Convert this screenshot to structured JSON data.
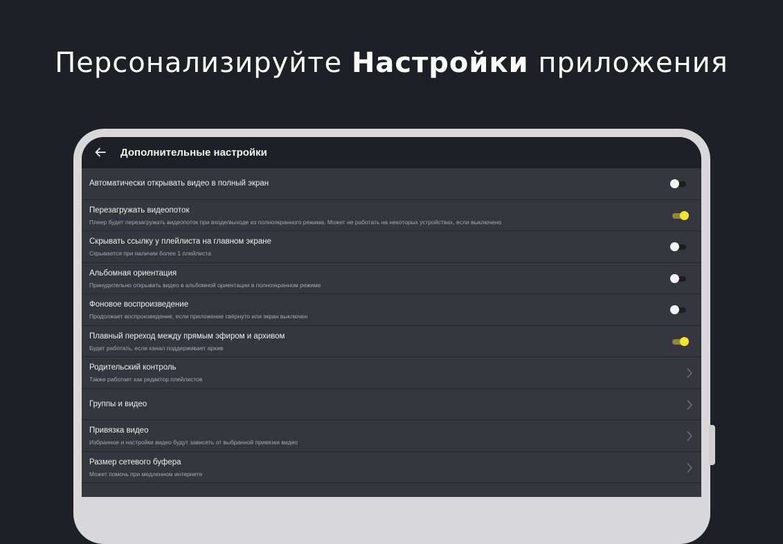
{
  "headline": {
    "prefix": "Персонализируйте",
    "bold": "Настройки",
    "suffix": "приложения"
  },
  "appbar": {
    "title": "Дополнительные настройки",
    "back_icon": "arrow-left-icon"
  },
  "colors": {
    "background": "#1f1f27",
    "row": "#36363f",
    "accent": "#f3e52e"
  },
  "settings": [
    {
      "title": "Автоматически открывать видео в полный экран",
      "subtitle": "",
      "control": "toggle",
      "on": false
    },
    {
      "title": "Перезагружать видеопоток",
      "subtitle": "Плеер будет перезагружать видеопоток при входе/выходе из полноэкранного режима. Может не работать на некоторых устройствах, если выключено",
      "control": "toggle",
      "on": true
    },
    {
      "title": "Скрывать ссылку у плейлиста на главном экране",
      "subtitle": "Скрывается при наличии более 1 плейлиста",
      "control": "toggle",
      "on": false
    },
    {
      "title": "Альбомная ориентация",
      "subtitle": "Принудительно открывать видео в альбомной ориентации в полноэкранном режиме",
      "control": "toggle",
      "on": false
    },
    {
      "title": "Фоновое воспроизведение",
      "subtitle": "Продолжает воспроизведение, если приложение свёрнуто или экран выключен",
      "control": "toggle",
      "on": false
    },
    {
      "title": "Плавный переход между прямым эфиром и архивом",
      "subtitle": "Будет работать, если канал поддерживает архив",
      "control": "toggle",
      "on": true
    },
    {
      "title": "Родительский контроль",
      "subtitle": "Также работает как редактор плейлистов",
      "control": "chevron"
    },
    {
      "title": "Группы и видео",
      "subtitle": "",
      "control": "chevron"
    },
    {
      "title": "Привязка видео",
      "subtitle": "Избранное и настройки видео будут зависеть от выбранной привязки видео",
      "control": "chevron"
    },
    {
      "title": "Размер сетевого буфера",
      "subtitle": "Может помочь при медленном интернете",
      "control": "chevron"
    }
  ]
}
